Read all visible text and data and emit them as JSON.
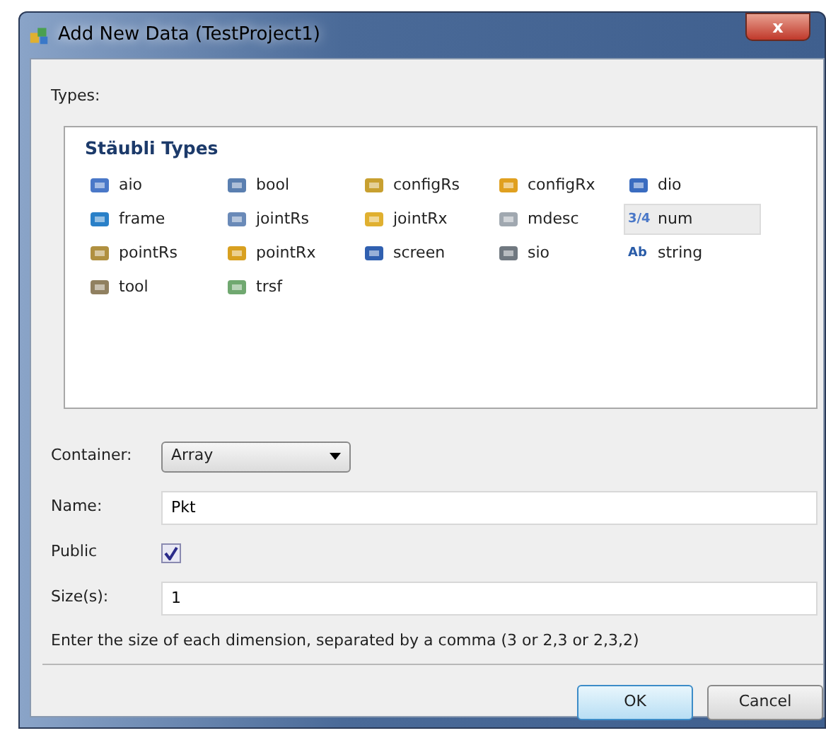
{
  "window": {
    "title": "Add New Data (TestProject1)",
    "close_label": "x"
  },
  "types_label": "Types:",
  "group": {
    "title": "Stäubli Types",
    "items": [
      {
        "label": "aio",
        "selected": false,
        "color": "#4a78c8"
      },
      {
        "label": "bool",
        "selected": false,
        "color": "#5a7fb0"
      },
      {
        "label": "configRs",
        "selected": false,
        "color": "#c8a030"
      },
      {
        "label": "configRx",
        "selected": false,
        "color": "#e0a020"
      },
      {
        "label": "dio",
        "selected": false,
        "color": "#3a6cc0"
      },
      {
        "label": "frame",
        "selected": false,
        "color": "#2a80c8"
      },
      {
        "label": "jointRs",
        "selected": false,
        "color": "#6a8ab8"
      },
      {
        "label": "jointRx",
        "selected": false,
        "color": "#e0b030"
      },
      {
        "label": "mdesc",
        "selected": false,
        "color": "#a0a8b0"
      },
      {
        "label": "num",
        "selected": true,
        "color": "#4a78c8",
        "glyph": "3/4"
      },
      {
        "label": "pointRs",
        "selected": false,
        "color": "#b09040"
      },
      {
        "label": "pointRx",
        "selected": false,
        "color": "#d8a020"
      },
      {
        "label": "screen",
        "selected": false,
        "color": "#3060b0"
      },
      {
        "label": "sio",
        "selected": false,
        "color": "#707880"
      },
      {
        "label": "string",
        "selected": false,
        "color": "#2a5ca8",
        "glyph": "Ab"
      },
      {
        "label": "tool",
        "selected": false,
        "color": "#908060"
      },
      {
        "label": "trsf",
        "selected": false,
        "color": "#70a870"
      }
    ]
  },
  "container": {
    "label": "Container:",
    "value": "Array"
  },
  "name": {
    "label": "Name:",
    "value": "Pkt"
  },
  "public": {
    "label": "Public",
    "checked": true
  },
  "sizes": {
    "label": "Size(s):",
    "value": "1"
  },
  "hint": "Enter the size of each dimension, separated by a comma (3 or 2,3 or 2,3,2)",
  "buttons": [
    {
      "label": "OK",
      "default": true
    },
    {
      "label": "Cancel",
      "default": false
    }
  ]
}
